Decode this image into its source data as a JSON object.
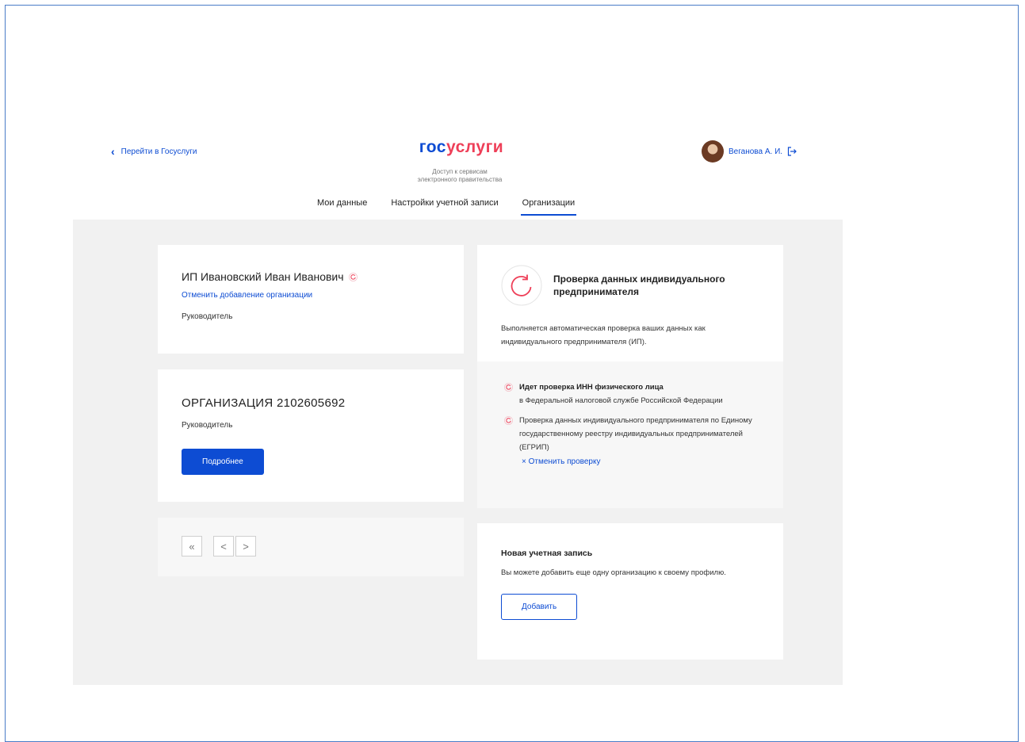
{
  "header": {
    "back_link": "Перейти в Госуслуги",
    "logo_part1": "гос",
    "logo_part2": "услуги",
    "tagline_line1": "Доступ к сервисам",
    "tagline_line2": "электронного правительства",
    "user_name": "Веганова А. И."
  },
  "tabs": [
    {
      "label": "Мои данные",
      "active": false
    },
    {
      "label": "Настройки учетной записи",
      "active": false
    },
    {
      "label": "Организации",
      "active": true
    }
  ],
  "org1": {
    "name": "ИП Ивановский Иван Иванович",
    "cancel_link": "Отменить добавление организации",
    "role": "Руководитель"
  },
  "org2": {
    "name": "ОРГАНИЗАЦИЯ 2102605692",
    "role": "Руководитель",
    "details_button": "Подробнее"
  },
  "pager": {
    "first": "«",
    "prev": "<",
    "next": ">"
  },
  "check": {
    "title_line1": "Проверка данных индивидуального",
    "title_line2": "предпринимателя",
    "desc": "Выполняется автоматическая проверка ваших данных как индивидуального предпринимателя (ИП).",
    "item1_bold": "Идет проверка ИНН физического лица",
    "item1_rest": "в Федеральной налоговой службе Российской Федерации",
    "item2": "Проверка данных индивидуального предпринимателя по Единому государственному реестру индивидуальных предпринимателей (ЕГРИП)",
    "cancel_label": "× Отменить проверку"
  },
  "new_account": {
    "title": "Новая учетная запись",
    "desc": "Вы можете добавить еще одну организацию к своему профилю.",
    "button": "Добавить"
  },
  "colors": {
    "accent": "#0d4cd3",
    "brand_red": "#ee3f58",
    "panel_bg": "#f1f1f1"
  }
}
